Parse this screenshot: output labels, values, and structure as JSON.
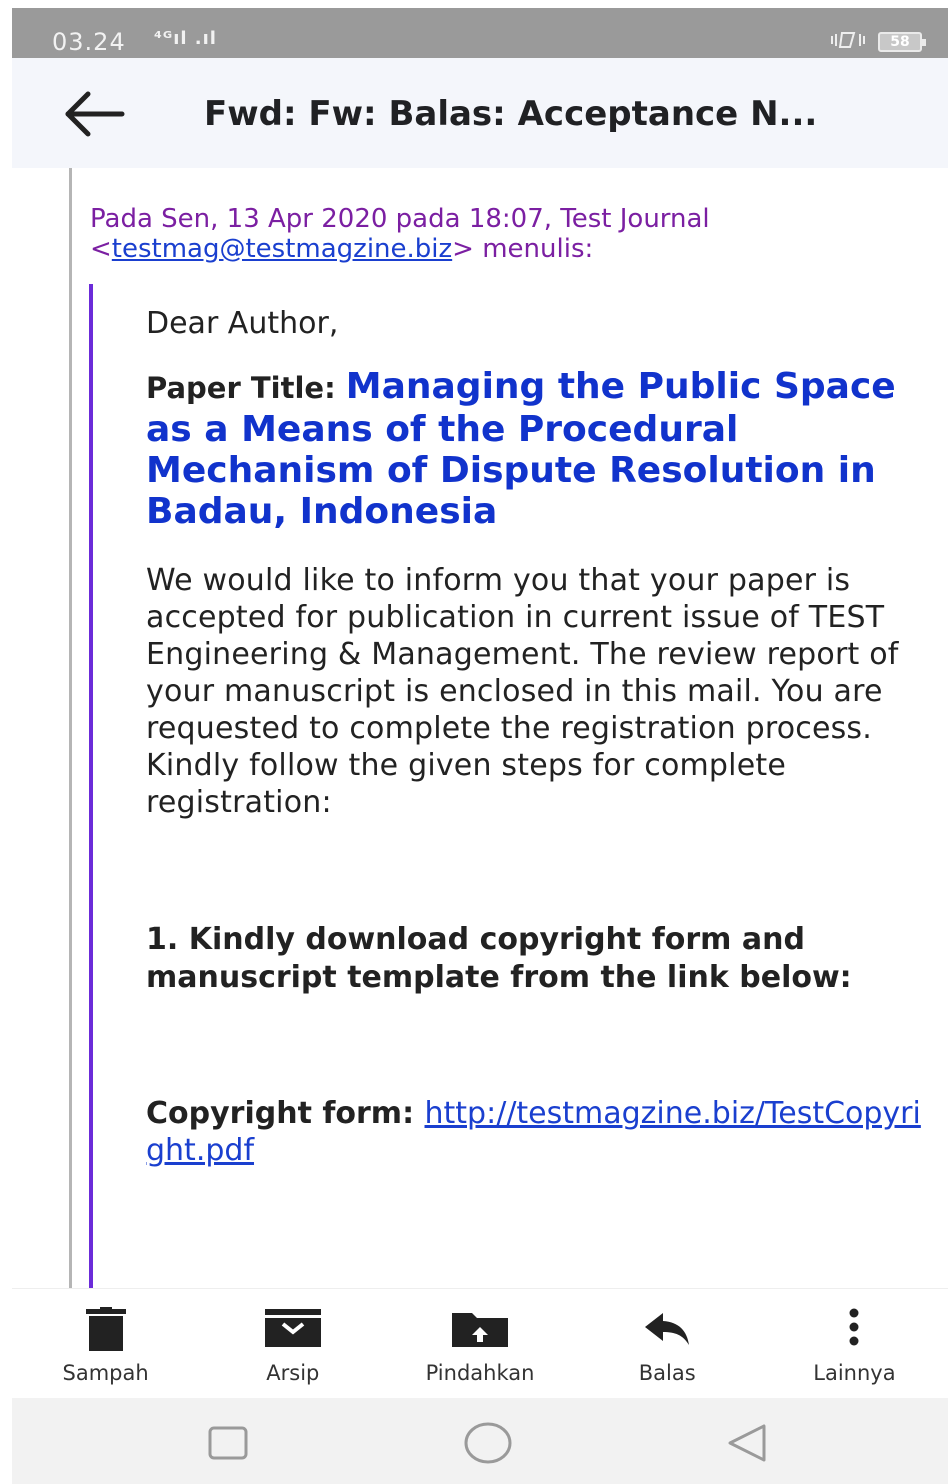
{
  "status_bar": {
    "time": "03.24",
    "signal": "⁴ᴳıl .ıl",
    "battery": "58"
  },
  "app_bar": {
    "title": "Fwd: Fw: Balas: Acceptance N..."
  },
  "quote_header": {
    "prefix": "Pada Sen, 13 Apr 2020 pada 18:07, Test Journal <",
    "email": "testmag@testmagzine.biz",
    "suffix": "> menulis:"
  },
  "mail": {
    "greeting": "Dear Author,",
    "paper_title_label": "Paper Title: ",
    "paper_title": "Managing the Public Space as a Means of the Procedural Mechanism of Dispute Resolution in Badau, Indonesia",
    "body": "We would like to inform you that your paper is accepted for publication in current issue of TEST Engineering & Management. The review report of your manuscript is enclosed in this mail. You are requested to complete the registration process. Kindly follow the given steps for complete registration:",
    "step1": "1. Kindly download copyright form and manuscript template from the link below:",
    "copyright_label": "Copyright form: ",
    "copyright_link": "http://testmagzine.biz/TestCopyright.pdf"
  },
  "actions": [
    {
      "label": "Sampah",
      "icon": "trash-icon"
    },
    {
      "label": "Arsip",
      "icon": "archive-icon"
    },
    {
      "label": "Pindahkan",
      "icon": "move-folder-icon"
    },
    {
      "label": "Balas",
      "icon": "reply-icon"
    },
    {
      "label": "Lainnya",
      "icon": "more-vertical-icon"
    }
  ],
  "colors": {
    "quote_header": "#7b1fa2",
    "link": "#1a3fcf",
    "paper_title": "#1133cc",
    "inner_quote_bar": "#6b2bd9"
  }
}
